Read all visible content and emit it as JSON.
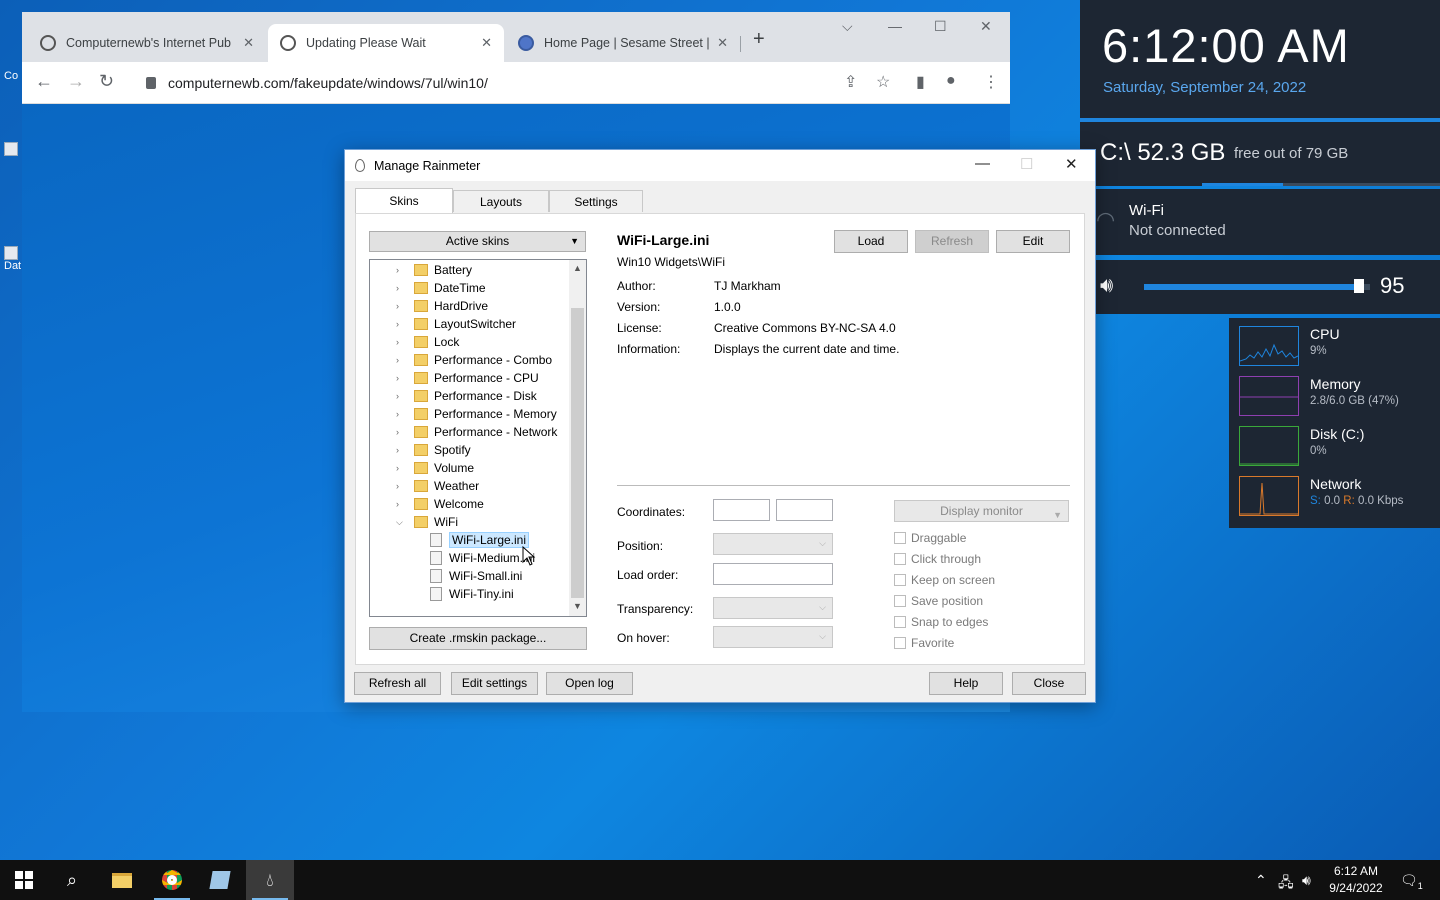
{
  "browser": {
    "tabs": [
      {
        "title": "Computernewb's Internet Pub H",
        "active": false
      },
      {
        "title": "Updating Please Wait",
        "active": true
      },
      {
        "title": "Home Page | Sesame Street | PB",
        "active": false
      }
    ],
    "new_tab": "+",
    "url": "computernewb.com/fakeupdate/windows/7ul/win10/",
    "icons": {
      "back": "arrow-left-icon",
      "forward": "arrow-right-icon",
      "reload": "reload-icon",
      "share": "share-icon",
      "star": "star-icon",
      "sidepanel": "side-panel-icon",
      "profile": "profile-icon",
      "menu": "kebab-menu-icon"
    }
  },
  "desktop": {
    "icon_labels": [
      "Co",
      "Dat"
    ]
  },
  "dialog": {
    "title": "Manage Rainmeter",
    "tabs": [
      "Skins",
      "Layouts",
      "Settings"
    ],
    "active_skins_label": "Active skins",
    "tree": [
      {
        "label": "Battery",
        "type": "folder",
        "expanded": false
      },
      {
        "label": "DateTime",
        "type": "folder",
        "expanded": false
      },
      {
        "label": "HardDrive",
        "type": "folder",
        "expanded": false
      },
      {
        "label": "LayoutSwitcher",
        "type": "folder",
        "expanded": false
      },
      {
        "label": "Lock",
        "type": "folder",
        "expanded": false
      },
      {
        "label": "Performance - Combo",
        "type": "folder",
        "expanded": false
      },
      {
        "label": "Performance - CPU",
        "type": "folder",
        "expanded": false
      },
      {
        "label": "Performance - Disk",
        "type": "folder",
        "expanded": false
      },
      {
        "label": "Performance - Memory",
        "type": "folder",
        "expanded": false
      },
      {
        "label": "Performance - Network",
        "type": "folder",
        "expanded": false
      },
      {
        "label": "Spotify",
        "type": "folder",
        "expanded": false
      },
      {
        "label": "Volume",
        "type": "folder",
        "expanded": false
      },
      {
        "label": "Weather",
        "type": "folder",
        "expanded": false
      },
      {
        "label": "Welcome",
        "type": "folder",
        "expanded": false
      },
      {
        "label": "WiFi",
        "type": "folder",
        "expanded": true
      },
      {
        "label": "WiFi-Large.ini",
        "type": "file",
        "selected": true
      },
      {
        "label": "WiFi-Medium.ini",
        "type": "file"
      },
      {
        "label": "WiFi-Small.ini",
        "type": "file"
      },
      {
        "label": "WiFi-Tiny.ini",
        "type": "file"
      }
    ],
    "create_package": "Create .rmskin package...",
    "skin": {
      "name": "WiFi-Large.ini",
      "path": "Win10 Widgets\\WiFi",
      "author_label": "Author:",
      "author": "TJ Markham",
      "version_label": "Version:",
      "version": "1.0.0",
      "license_label": "License:",
      "license": "Creative Commons BY-NC-SA 4.0",
      "information_label": "Information:",
      "information": "Displays the current date and time."
    },
    "buttons": {
      "load": "Load",
      "refresh": "Refresh",
      "edit": "Edit"
    },
    "fields": {
      "coordinates": "Coordinates:",
      "position": "Position:",
      "load_order": "Load order:",
      "transparency": "Transparency:",
      "on_hover": "On hover:",
      "display_monitor": "Display monitor"
    },
    "checkboxes": [
      "Draggable",
      "Click through",
      "Keep on screen",
      "Save position",
      "Snap to edges",
      "Favorite"
    ],
    "footer": {
      "refresh_all": "Refresh all",
      "edit_settings": "Edit settings",
      "open_log": "Open log",
      "help": "Help",
      "close": "Close"
    }
  },
  "widgets": {
    "time": "6:12:00 AM",
    "date": "Saturday, September 24, 2022",
    "disk_label": "C:\\  52.3 GB",
    "disk_free": "free out of 79 GB",
    "disk_used_fraction": 0.34,
    "wifi_title": "Wi-Fi",
    "wifi_status": "Not connected",
    "volume": "95",
    "volume_fraction": 0.95,
    "perf": [
      {
        "name": "CPU",
        "value": "9%",
        "color": "#1f85de"
      },
      {
        "name": "Memory",
        "value": "2.8/6.0 GB (47%)",
        "color": "#8e3fb0"
      },
      {
        "name": "Disk (C:)",
        "value": "0%",
        "color": "#3aa83a"
      },
      {
        "name": "Network",
        "value_s": "S:",
        "value_s_num": "0.0",
        "value_r": "R:",
        "value_r_num": "0.0 Kbps",
        "color": "#d9792b"
      }
    ]
  },
  "taskbar": {
    "time": "6:12 AM",
    "date": "9/24/2022",
    "notification_count": "1"
  }
}
